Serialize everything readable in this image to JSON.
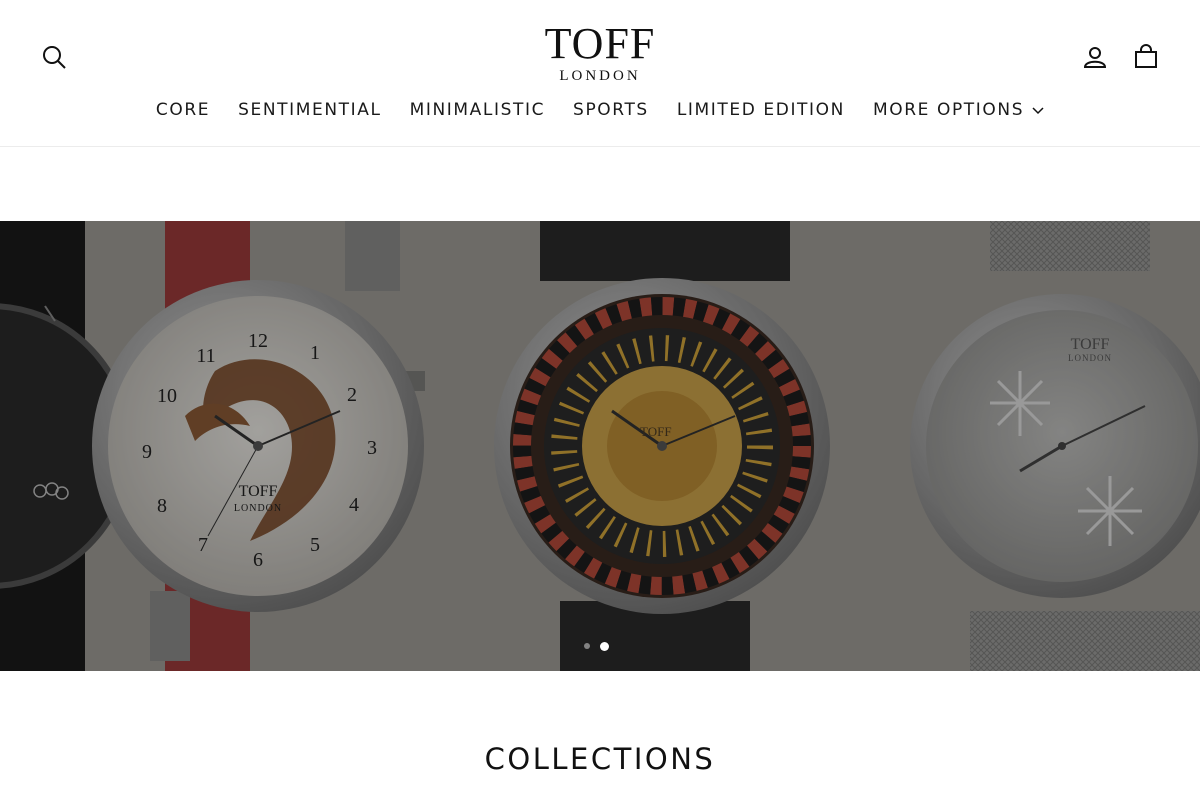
{
  "header": {
    "logo_main": "TOFF",
    "logo_sub": "LONDON",
    "icons": {
      "search": "search-icon",
      "account": "user-icon",
      "cart": "shopping-bag-icon"
    }
  },
  "nav": {
    "items": [
      {
        "label": "CORE"
      },
      {
        "label": "SENTIMENTIAL"
      },
      {
        "label": "MINIMALISTIC"
      },
      {
        "label": "SPORTS"
      },
      {
        "label": "LIMITED EDITION"
      },
      {
        "label": "MORE OPTIONS",
        "icon": "chevron-down-icon"
      }
    ]
  },
  "hero": {
    "slide_count": 2,
    "active_slide": 2,
    "watches": [
      {
        "name": "dragon-watch",
        "brand": "TOFF",
        "brand_sub": "LONDON"
      },
      {
        "name": "roulette-watch",
        "brand": "TOFF"
      },
      {
        "name": "snowflake-watch",
        "brand": "TOFF",
        "brand_sub": "LONDON"
      }
    ]
  },
  "sections": {
    "collections_title": "COLLECTIONS"
  },
  "colors": {
    "text": "#111111",
    "hero_overlay": "rgba(0,0,0,0.30)",
    "active_dot": "#ffffff",
    "strap_red": "#9a3a3a"
  }
}
